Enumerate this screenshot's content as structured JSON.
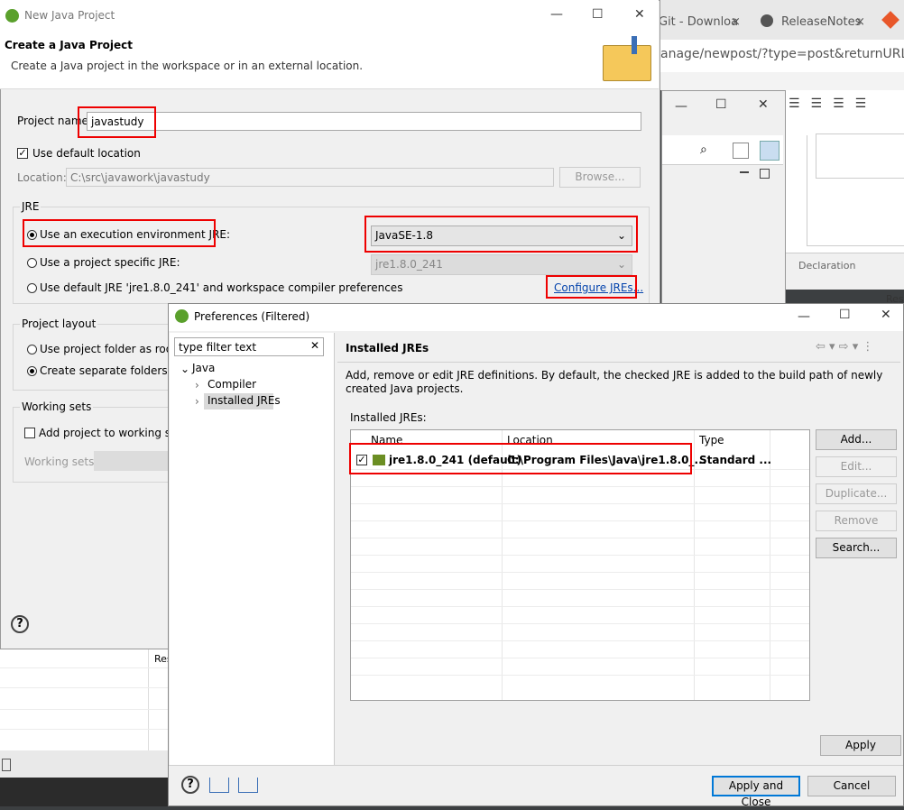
{
  "browser": {
    "tabs": [
      {
        "label": "Git - Downloa",
        "close": "×"
      },
      {
        "label": "ReleaseNotes",
        "close": "×"
      }
    ],
    "url": "anage/newpost/?type=post&returnURL=%2",
    "extra_panel_labels": [
      "Declaration",
      "Res"
    ]
  },
  "wizard": {
    "title": "New Java Project",
    "header_title": "Create a Java Project",
    "header_desc": "Create a Java project in the workspace or in an external location.",
    "project_name_label": "Project name:",
    "project_name_value": "javastudy",
    "use_default_location": "Use default location",
    "location_label": "Location:",
    "location_value": "C:\\src\\javawork\\javastudy",
    "browse": "Browse...",
    "jre_group": "JRE",
    "jre_options": [
      "Use an execution environment JRE:",
      "Use a project specific JRE:",
      "Use default JRE 'jre1.8.0_241' and workspace compiler preferences"
    ],
    "env_combo": "JavaSE-1.8",
    "specific_combo": "jre1.8.0_241",
    "configure_link": "Configure JREs...",
    "layout_group": "Project layout",
    "layout_options": [
      "Use project folder as root f",
      "Create separate folders for"
    ],
    "working_sets_group": "Working sets",
    "add_working_set": "Add project to working set",
    "working_sets_label": "Working sets:",
    "bottom_label": "Res"
  },
  "prefs": {
    "title": "Preferences (Filtered)",
    "filter_placeholder": "type filter text",
    "tree": {
      "root": "Java",
      "children": [
        "Compiler",
        "Installed JREs"
      ]
    },
    "page_title": "Installed JREs",
    "description": "Add, remove or edit JRE definitions. By default, the checked JRE is added to the build path of newly created Java projects.",
    "list_label": "Installed JREs:",
    "columns": [
      "Name",
      "Location",
      "Type"
    ],
    "rows": [
      {
        "name": "jre1.8.0_241 (default)",
        "location": "C:\\Program Files\\Java\\jre1.8.0_...",
        "type": "Standard ..."
      }
    ],
    "buttons": [
      "Add...",
      "Edit...",
      "Duplicate...",
      "Remove",
      "Search..."
    ],
    "apply": "Apply",
    "apply_close": "Apply and Close",
    "cancel": "Cancel"
  }
}
